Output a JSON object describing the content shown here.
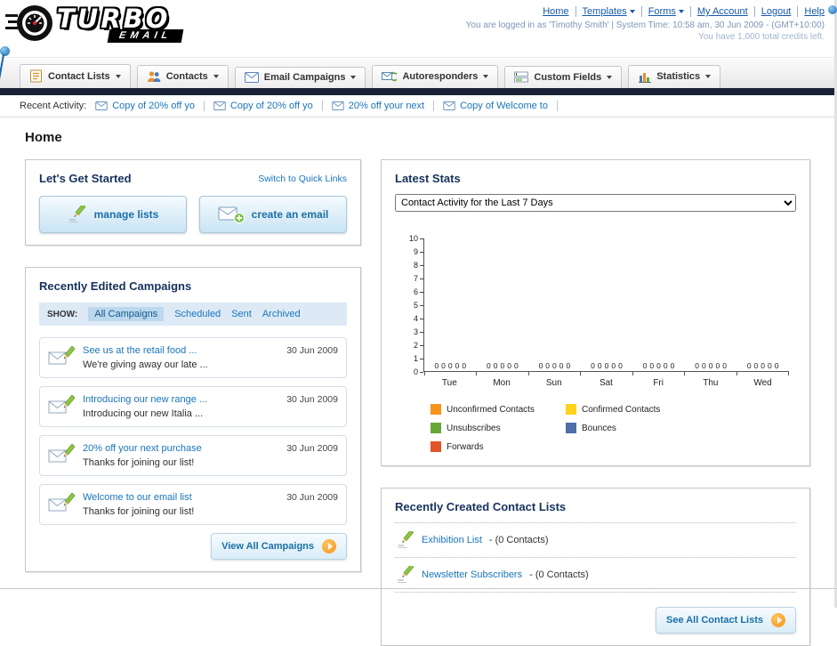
{
  "theme": {
    "link_color": "#1a75bb",
    "dark_bar_color": "#1a2238",
    "button_text_color": "#1a6fa8",
    "arrow_orange": "#f7941e"
  },
  "header": {
    "logo_title": "TURBO",
    "logo_subtitle": "EMAIL",
    "nav": {
      "home": "Home",
      "templates": "Templates",
      "forms": "Forms",
      "my_account": "My Account",
      "logout": "Logout",
      "help": "Help"
    },
    "login_info": "You are logged in as 'Timothy Smith' | System Time: 10:58 am, 30 Jun 2009 - (GMT+10:00)",
    "credits_info": "You have 1,000 total credits left."
  },
  "nav_tabs": [
    {
      "label": "Contact Lists"
    },
    {
      "label": "Contacts"
    },
    {
      "label": "Email Campaigns"
    },
    {
      "label": "Autoresponders"
    },
    {
      "label": "Custom Fields"
    },
    {
      "label": "Statistics"
    }
  ],
  "recent_activity": {
    "label": "Recent Activity:",
    "items": [
      "Copy of 20% off yo",
      "Copy of 20% off yo",
      "20% off your next",
      "Copy of Welcome to"
    ]
  },
  "page": {
    "title": "Home"
  },
  "get_started": {
    "title": "Let's Get Started",
    "switch_link": "Switch to Quick Links",
    "manage_lists_label": "manage lists",
    "create_email_label": "create an email"
  },
  "campaigns": {
    "title": "Recently Edited Campaigns",
    "show_label": "SHOW:",
    "filters": [
      "All Campaigns",
      "Scheduled",
      "Sent",
      "Archived"
    ],
    "active_filter": "All Campaigns",
    "items": [
      {
        "title": "See us at the retail food ...",
        "subtitle": "We're giving away our late ...",
        "date": "30 Jun 2009"
      },
      {
        "title": "Introducing our new range ...",
        "subtitle": "Introducing our new Italia ...",
        "date": "30 Jun 2009"
      },
      {
        "title": "20% off your next purchase",
        "subtitle": "Thanks for joining our list!",
        "date": "30 Jun 2009"
      },
      {
        "title": "Welcome to our email list",
        "subtitle": "Thanks for joining our list!",
        "date": "30 Jun 2009"
      }
    ],
    "view_all_label": "View All Campaigns"
  },
  "stats": {
    "title": "Latest Stats",
    "activity_dropdown_value": "Contact Activity for the Last 7 Days",
    "legend": [
      {
        "label": "Unconfirmed Contacts",
        "color": "#f7941e"
      },
      {
        "label": "Confirmed Contacts",
        "color": "#ffd21e"
      },
      {
        "label": "Unsubscribes",
        "color": "#66a838"
      },
      {
        "label": "Bounces",
        "color": "#4e6fa8"
      },
      {
        "label": "Forwards",
        "color": "#e2542b"
      }
    ]
  },
  "chart_data": {
    "type": "bar",
    "title": "Contact Activity for the Last 7 Days",
    "categories": [
      "Tue",
      "Mon",
      "Sun",
      "Sat",
      "Fri",
      "Thu",
      "Wed"
    ],
    "series": [
      {
        "name": "Unconfirmed Contacts",
        "values": [
          0,
          0,
          0,
          0,
          0,
          0,
          0
        ]
      },
      {
        "name": "Confirmed Contacts",
        "values": [
          0,
          0,
          0,
          0,
          0,
          0,
          0
        ]
      },
      {
        "name": "Unsubscribes",
        "values": [
          0,
          0,
          0,
          0,
          0,
          0,
          0
        ]
      },
      {
        "name": "Bounces",
        "values": [
          0,
          0,
          0,
          0,
          0,
          0,
          0
        ]
      },
      {
        "name": "Forwards",
        "values": [
          0,
          0,
          0,
          0,
          0,
          0,
          0
        ]
      }
    ],
    "ylim": [
      0,
      10
    ],
    "ytick_step": 1,
    "grid": false,
    "legend_position": "bottom"
  },
  "contact_lists": {
    "title": "Recently Created Contact Lists",
    "items": [
      {
        "name": "Exhibition List",
        "detail": "- (0 Contacts)"
      },
      {
        "name": "Newsletter Subscribers",
        "detail": "- (0 Contacts)"
      }
    ],
    "see_all_label": "See All Contact Lists"
  }
}
